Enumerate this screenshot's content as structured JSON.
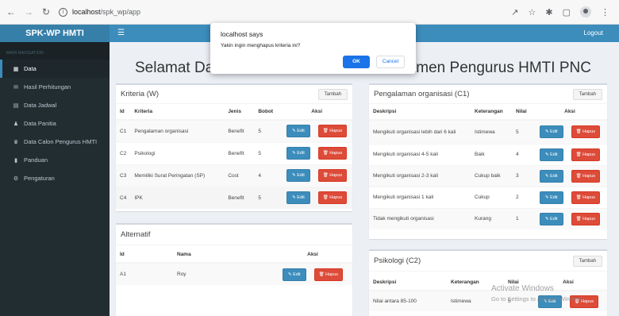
{
  "browser": {
    "url_host": "localhost",
    "url_path": "/spk_wp/app"
  },
  "header": {
    "logo": "SPK-WP HMTI",
    "menu_icon": "bars-icon",
    "logout": "Logout"
  },
  "sidebar": {
    "section": "MAIN NAVIGATION",
    "items": [
      {
        "label": "Data",
        "icon": "table-icon"
      },
      {
        "label": "Hasil Perhitungan",
        "icon": "envelope-icon"
      },
      {
        "label": "Data Jadwal",
        "icon": "list-icon"
      },
      {
        "label": "Data Panitia",
        "icon": "user-icon"
      },
      {
        "label": "Data Calon Pengurus HMTI",
        "icon": "users-icon"
      },
      {
        "label": "Panduan",
        "icon": "book-icon"
      },
      {
        "label": "Pengaturan",
        "icon": "gear-icon"
      }
    ]
  },
  "title": {
    "left": "Selamat Da",
    "right": "tmen Pengurus HMTI PNC"
  },
  "dialog": {
    "title": "localhost says",
    "message": "Yakin ingin menghapus kriteria ini?",
    "ok": "OK",
    "cancel": "Cancel"
  },
  "buttons": {
    "tambah": "Tambah",
    "edit": "Edit",
    "hapus": "Hapus"
  },
  "kriteria": {
    "title": "Kriteria (W)",
    "columns": [
      "Id",
      "Kriteria",
      "Jenis",
      "Bobot",
      "Aksi"
    ],
    "rows": [
      {
        "id": "C1",
        "kriteria": "Pengalaman organisasi",
        "jenis": "Benefit",
        "bobot": "5"
      },
      {
        "id": "C2",
        "kriteria": "Psikologi",
        "jenis": "Benefit",
        "bobot": "5"
      },
      {
        "id": "C3",
        "kriteria": "Memiliki Surat Peringatan (SP)",
        "jenis": "Cost",
        "bobot": "4"
      },
      {
        "id": "C4",
        "kriteria": "IPK",
        "jenis": "Benefit",
        "bobot": "5"
      }
    ]
  },
  "alternatif": {
    "title": "Alternatif",
    "columns": [
      "Id",
      "Nama",
      "Aksi"
    ],
    "rows": [
      {
        "id": "A1",
        "nama": "Roy"
      }
    ]
  },
  "pengalaman": {
    "title": "Pengalaman organisasi (C1)",
    "columns": [
      "Deskripsi",
      "Keterangan",
      "Nilai",
      "Aksi"
    ],
    "rows": [
      {
        "deskripsi": "Mengikuti organisasi lebih dari 6 kali",
        "keterangan": "Istimewa",
        "nilai": "5"
      },
      {
        "deskripsi": "Mengikuti organisasi 4-5 kali",
        "keterangan": "Baik",
        "nilai": "4"
      },
      {
        "deskripsi": "Mengikuti organisasi 2-3 kali",
        "keterangan": "Cukup baik",
        "nilai": "3"
      },
      {
        "deskripsi": "Mengikuti organisasi 1 kali",
        "keterangan": "Cukup",
        "nilai": "2"
      },
      {
        "deskripsi": "Tidak mengikuti organisasi",
        "keterangan": "Kurang",
        "nilai": "1"
      }
    ]
  },
  "psikologi": {
    "title": "Psikologi (C2)",
    "columns": [
      "Deskripsi",
      "Keterangan",
      "Nilai",
      "Aksi"
    ],
    "rows": [
      {
        "deskripsi": "Nilai antara 85-100",
        "keterangan": "Istimewa",
        "nilai": "5"
      }
    ]
  },
  "watermark": {
    "line1": "Activate Windows",
    "line2": "Go to Settings to activate Windows."
  }
}
